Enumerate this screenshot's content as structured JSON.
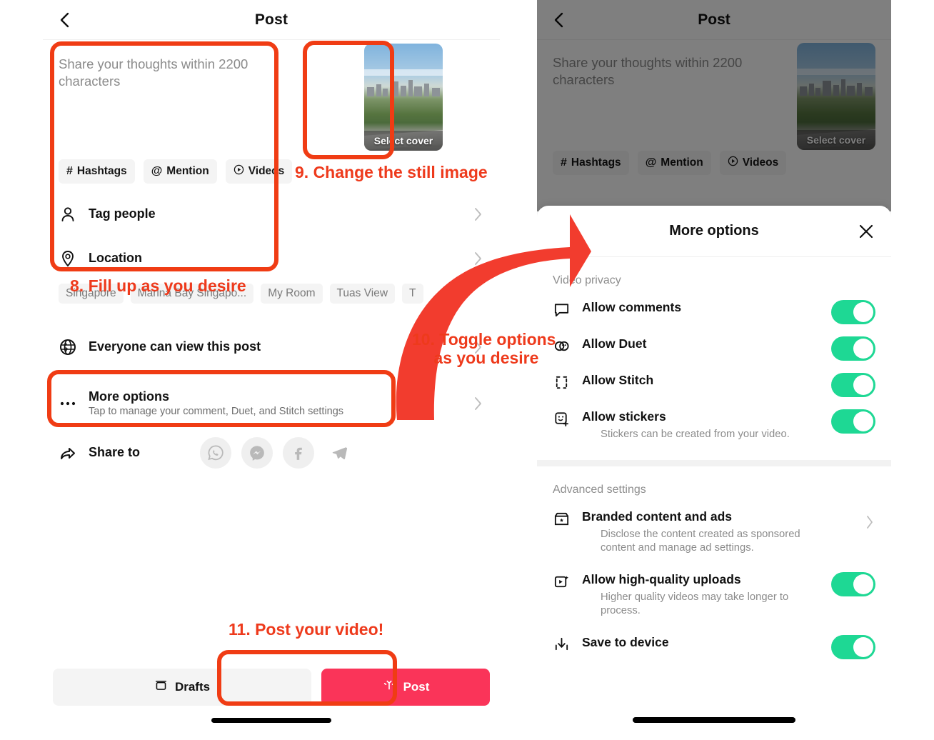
{
  "left_phone": {
    "navbar": {
      "back_icon": "chevron-left-icon",
      "title": "Post"
    },
    "compose": {
      "placeholder": "Share your thoughts within 2200 characters",
      "chips": [
        {
          "glyph": "#",
          "label": "Hashtags"
        },
        {
          "glyph": "@",
          "label": "Mention"
        },
        {
          "glyph": "▶",
          "label": "Videos"
        }
      ]
    },
    "cover": {
      "caption": "Select cover"
    },
    "rows": [
      {
        "icon": "person-icon",
        "label": "Tag people"
      },
      {
        "icon": "location-pin-icon",
        "label": "Location"
      }
    ],
    "location_chips": [
      "Singapore",
      "Marina Bay Singapo...",
      "My Room",
      "Tuas View",
      "T"
    ],
    "privacy_row": {
      "icon": "globe-icon",
      "label": "Everyone can view this post"
    },
    "more_options_row": {
      "icon": "ellipsis-icon",
      "label": "More options",
      "sub": "Tap to manage your comment, Duet, and Stitch settings"
    },
    "share_row": {
      "icon": "share-arrow-icon",
      "label": "Share to",
      "targets": [
        "whatsapp-icon",
        "messenger-icon",
        "facebook-icon",
        "telegram-icon"
      ]
    },
    "bottom": {
      "drafts_label": "Drafts",
      "drafts_icon": "drafts-box-icon",
      "post_label": "Post",
      "post_icon": "sparkle-icon",
      "post_color": "#fa3459"
    }
  },
  "right_phone": {
    "navbar": {
      "back_icon": "chevron-left-icon",
      "title": "Post"
    },
    "compose": {
      "placeholder": "Share your thoughts within 2200 characters",
      "chips": [
        {
          "glyph": "#",
          "label": "Hashtags"
        },
        {
          "glyph": "@",
          "label": "Mention"
        },
        {
          "glyph": "▶",
          "label": "Videos"
        }
      ]
    },
    "cover": {
      "caption": "Select cover"
    },
    "sheet": {
      "title": "More options",
      "close_icon": "close-x-icon",
      "sections": [
        {
          "label": "Video privacy",
          "items": [
            {
              "icon": "comment-bubble-icon",
              "name": "Allow comments",
              "desc": "",
              "toggle": true
            },
            {
              "icon": "duet-icon",
              "name": "Allow Duet",
              "desc": "",
              "toggle": true
            },
            {
              "icon": "stitch-brackets-icon",
              "name": "Allow Stitch",
              "desc": "",
              "toggle": true
            },
            {
              "icon": "sticker-face-icon",
              "name": "Allow stickers",
              "desc": "Stickers can be created from your video.",
              "toggle": true
            }
          ]
        },
        {
          "label": "Advanced settings",
          "items": [
            {
              "icon": "branded-content-icon",
              "name": "Branded content and ads",
              "desc": "Disclose the content created as sponsored content and manage ad settings.",
              "chevron": true
            },
            {
              "icon": "high-quality-upload-icon",
              "name": "Allow high-quality uploads",
              "desc": "Higher quality videos may take longer to process.",
              "toggle": true
            },
            {
              "icon": "save-download-icon",
              "name": "Save to device",
              "desc": "",
              "toggle": true
            }
          ]
        }
      ],
      "toggle_on_color": "#1ed894"
    }
  },
  "annotations": {
    "color": "#ee3a1c",
    "step8": "8. Fill up as you desire",
    "step9": "9. Change the still image",
    "step10": "10. Toggle options\n as you desire",
    "step11": "11. Post your video!",
    "arrow_icon": "curved-red-arrow-icon"
  }
}
